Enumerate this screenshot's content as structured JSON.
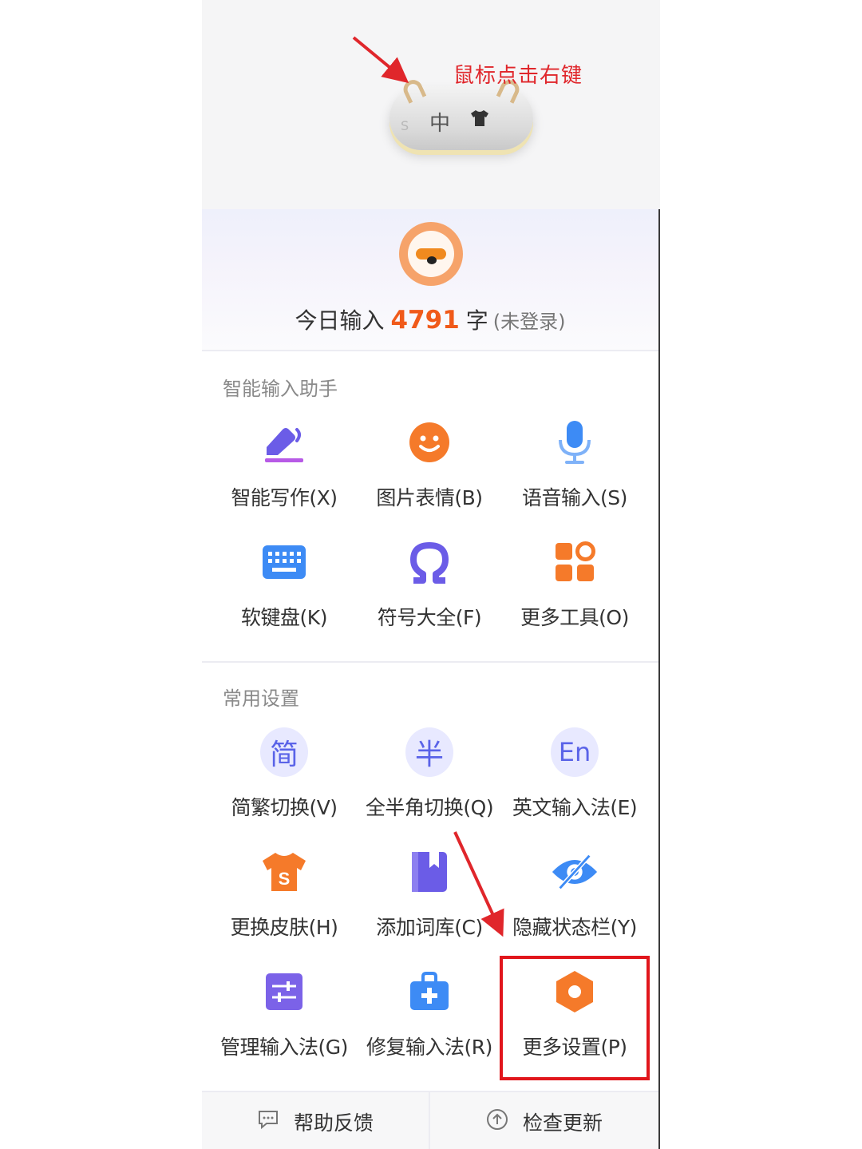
{
  "annotation": {
    "right_click_hint": "鼠标点击右键",
    "color": "#e0262b"
  },
  "status_bar": {
    "mode_char": "中",
    "skin_icon": "tshirt-icon",
    "logo_char": "S"
  },
  "profile": {
    "today_prefix": "今日输入",
    "today_count": "4791",
    "today_unit": "字",
    "login_status": "(未登录)"
  },
  "sections": {
    "assistant_title": "智能输入助手",
    "settings_title": "常用设置"
  },
  "assistant_items": [
    {
      "label": "智能写作(X)",
      "icon": "pen-icon"
    },
    {
      "label": "图片表情(B)",
      "icon": "smiley-icon"
    },
    {
      "label": "语音输入(S)",
      "icon": "microphone-icon"
    },
    {
      "label": "软键盘(K)",
      "icon": "keyboard-icon"
    },
    {
      "label": "符号大全(F)",
      "icon": "omega-icon"
    },
    {
      "label": "更多工具(O)",
      "icon": "apps-grid-icon"
    }
  ],
  "settings_items": [
    {
      "label": "简繁切换(V)",
      "icon": "simplified-icon",
      "glyph": "简"
    },
    {
      "label": "全半角切换(Q)",
      "icon": "halfwidth-icon",
      "glyph": "半"
    },
    {
      "label": "英文输入法(E)",
      "icon": "english-icon",
      "glyph": "En"
    },
    {
      "label": "更换皮肤(H)",
      "icon": "skin-tshirt-icon",
      "glyph": "S"
    },
    {
      "label": "添加词库(C)",
      "icon": "dictionary-icon"
    },
    {
      "label": "隐藏状态栏(Y)",
      "icon": "hide-eye-icon"
    },
    {
      "label": "管理输入法(G)",
      "icon": "manage-sliders-icon"
    },
    {
      "label": "修复输入法(R)",
      "icon": "repair-kit-icon"
    },
    {
      "label": "更多设置(P)",
      "icon": "settings-hexagon-icon"
    }
  ],
  "bottom": {
    "help_label": "帮助反馈",
    "update_label": "检查更新"
  },
  "colors": {
    "accent_purple": "#6b5ce7",
    "accent_orange": "#f57a2a",
    "accent_blue": "#3d8bf5",
    "highlight_red": "#e1161c",
    "count_orange": "#f05a1a"
  }
}
